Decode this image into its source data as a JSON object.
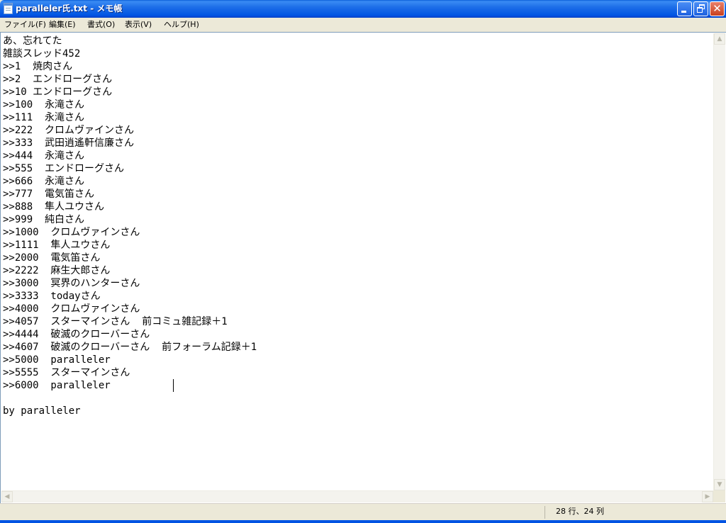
{
  "window": {
    "title": "paralleler氏.txt - メモ帳"
  },
  "titlebar": {
    "icon": "notepad-document-icon",
    "minimize_icon": "minimize-icon",
    "maximize_icon": "restore-icon",
    "close_icon": "close-icon",
    "close_glyph": "✕",
    "color_start": "#0a5fd8",
    "color_end": "#003dc4"
  },
  "menubar": {
    "file": "ファイル(F)",
    "edit": "編集(E)",
    "format": "書式(O)",
    "view": "表示(V)",
    "help": "ヘルプ(H)"
  },
  "editor": {
    "lines": [
      "あ、忘れてた",
      "雑談スレッド452",
      ">>1  焼肉さん",
      ">>2  エンドローグさん",
      ">>10 エンドローグさん",
      ">>100  永滝さん",
      ">>111  永滝さん",
      ">>222  クロムヴァインさん",
      ">>333  武田逍遙軒信廉さん",
      ">>444  永滝さん",
      ">>555  エンドローグさん",
      ">>666  永滝さん",
      ">>777  電気笛さん",
      ">>888  隼人ユウさん",
      ">>999  純白さん",
      ">>1000  クロムヴァインさん",
      ">>1111  隼人ユウさん",
      ">>2000  電気笛さん",
      ">>2222  麻生大郎さん",
      ">>3000  冥界のハンターさん",
      ">>3333  todayさん",
      ">>4000  クロムヴァインさん",
      ">>4057  スターマインさん  前コミュ雑記録＋1",
      ">>4444  破滅のクローバーさん",
      ">>4607  破滅のクローバーさん  前フォーラム記録＋1",
      ">>5000  paralleler",
      ">>5555  スターマインさん",
      ">>6000  paralleler",
      "",
      "by paralleler"
    ]
  },
  "scrollbars": {
    "up_glyph": "▲",
    "down_glyph": "▼",
    "left_glyph": "◀",
    "right_glyph": "▶"
  },
  "statusbar": {
    "position": "28 行、24 列"
  }
}
